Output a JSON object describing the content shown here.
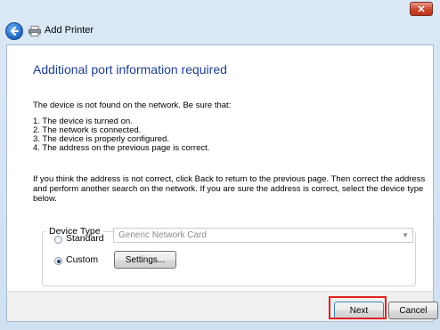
{
  "window": {
    "title": "Add Printer",
    "close_label": "✕"
  },
  "page": {
    "heading": "Additional port information required",
    "intro": "The device is not found on the network.  Be sure that:",
    "checklist": [
      "1.  The device is turned on.",
      "2.  The network is connected.",
      "3.  The device is properly configured.",
      "4.  The address on the previous page is correct."
    ],
    "instructions": "If you think the address is not correct, click Back to return to the previous page.  Then correct the address and perform another search on the network.  If you are sure the address is correct, select the device type below."
  },
  "device_type": {
    "label": "Device Type",
    "standard_label": "Standard",
    "standard_selected": false,
    "standard_value": "Generic Network Card",
    "custom_label": "Custom",
    "custom_selected": true,
    "settings_label": "Settings..."
  },
  "footer": {
    "next_label": "Next",
    "cancel_label": "Cancel"
  },
  "colors": {
    "heading": "#1e3e8f",
    "highlight": "#e02020"
  },
  "icons": {
    "back": "back-arrow-icon",
    "printer": "printer-icon",
    "dropdown": "chevron-down-icon"
  }
}
